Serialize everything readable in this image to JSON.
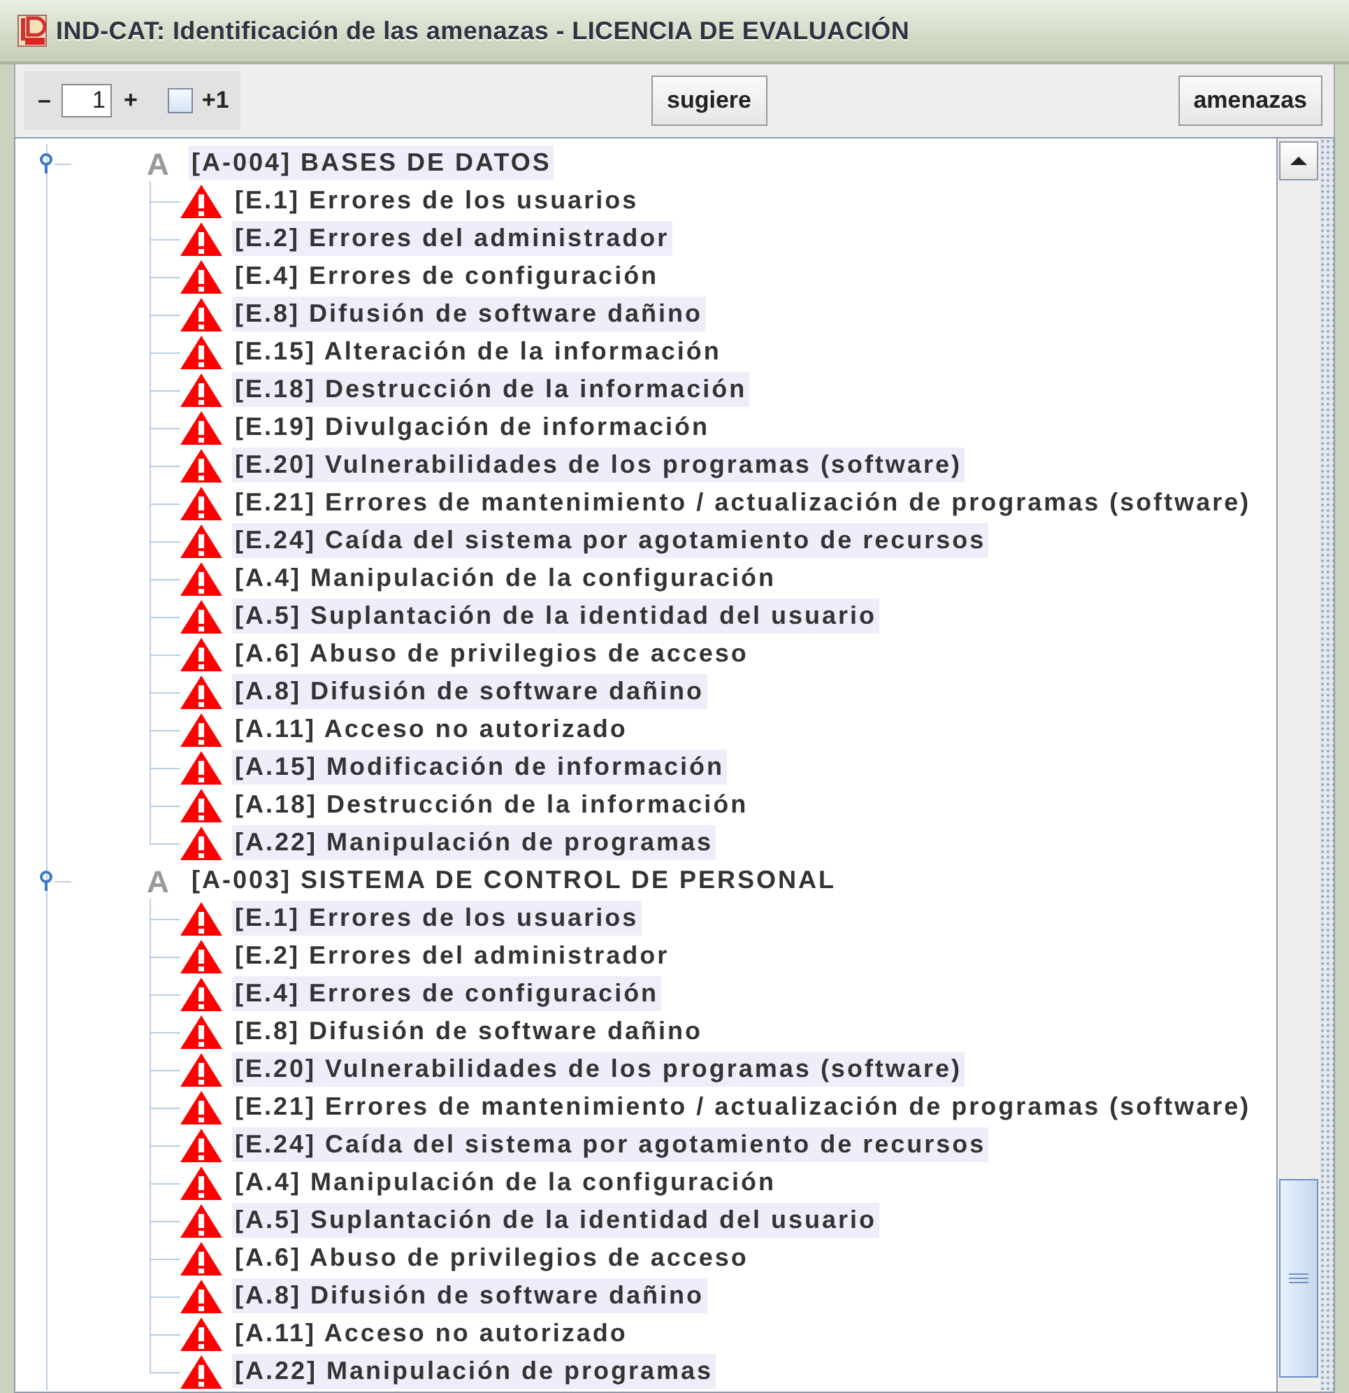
{
  "window": {
    "title": "IND-CAT: Identificación de las amenazas - LICENCIA DE EVALUACIÓN"
  },
  "toolbar": {
    "decrement": "–",
    "level_value": "1",
    "increment": "+",
    "checkbox": {
      "label": "+1",
      "checked": false
    },
    "buttons": [
      "sugiere",
      "amenazas"
    ]
  },
  "tree": {
    "groups": [
      {
        "icon_letter": "A",
        "label": "[A-004] BASES DE DATOS",
        "expanded": true,
        "children": [
          "[E.1] Errores de los usuarios",
          "[E.2] Errores del administrador",
          "[E.4] Errores de configuración",
          "[E.8] Difusión de software dañino",
          "[E.15] Alteración de la información",
          "[E.18] Destrucción de la información",
          "[E.19] Divulgación de información",
          "[E.20] Vulnerabilidades de los programas (software)",
          "[E.21] Errores de mantenimiento / actualización de programas (software)",
          "[E.24] Caída del sistema por agotamiento de recursos",
          "[A.4] Manipulación de la configuración",
          "[A.5] Suplantación de la identidad del usuario",
          "[A.6] Abuso de privilegios de acceso",
          "[A.8] Difusión de software dañino",
          "[A.11] Acceso no autorizado",
          "[A.15] Modificación de información",
          "[A.18] Destrucción de la información",
          "[A.22] Manipulación de programas"
        ]
      },
      {
        "icon_letter": "A",
        "label": "[A-003] SISTEMA DE CONTROL DE PERSONAL",
        "expanded": true,
        "children": [
          "[E.1] Errores de los usuarios",
          "[E.2] Errores del administrador",
          "[E.4] Errores de configuración",
          "[E.8] Difusión de software dañino",
          "[E.20] Vulnerabilidades de los programas (software)",
          "[E.21] Errores de mantenimiento / actualización de programas (software)",
          "[E.24] Caída del sistema por agotamiento de recursos",
          "[A.4] Manipulación de la configuración",
          "[A.5] Suplantación de la identidad del usuario",
          "[A.6] Abuso de privilegios de acceso",
          "[A.8] Difusión de software dañino",
          "[A.11] Acceso no autorizado",
          "[A.22] Manipulación de programas"
        ]
      }
    ]
  }
}
